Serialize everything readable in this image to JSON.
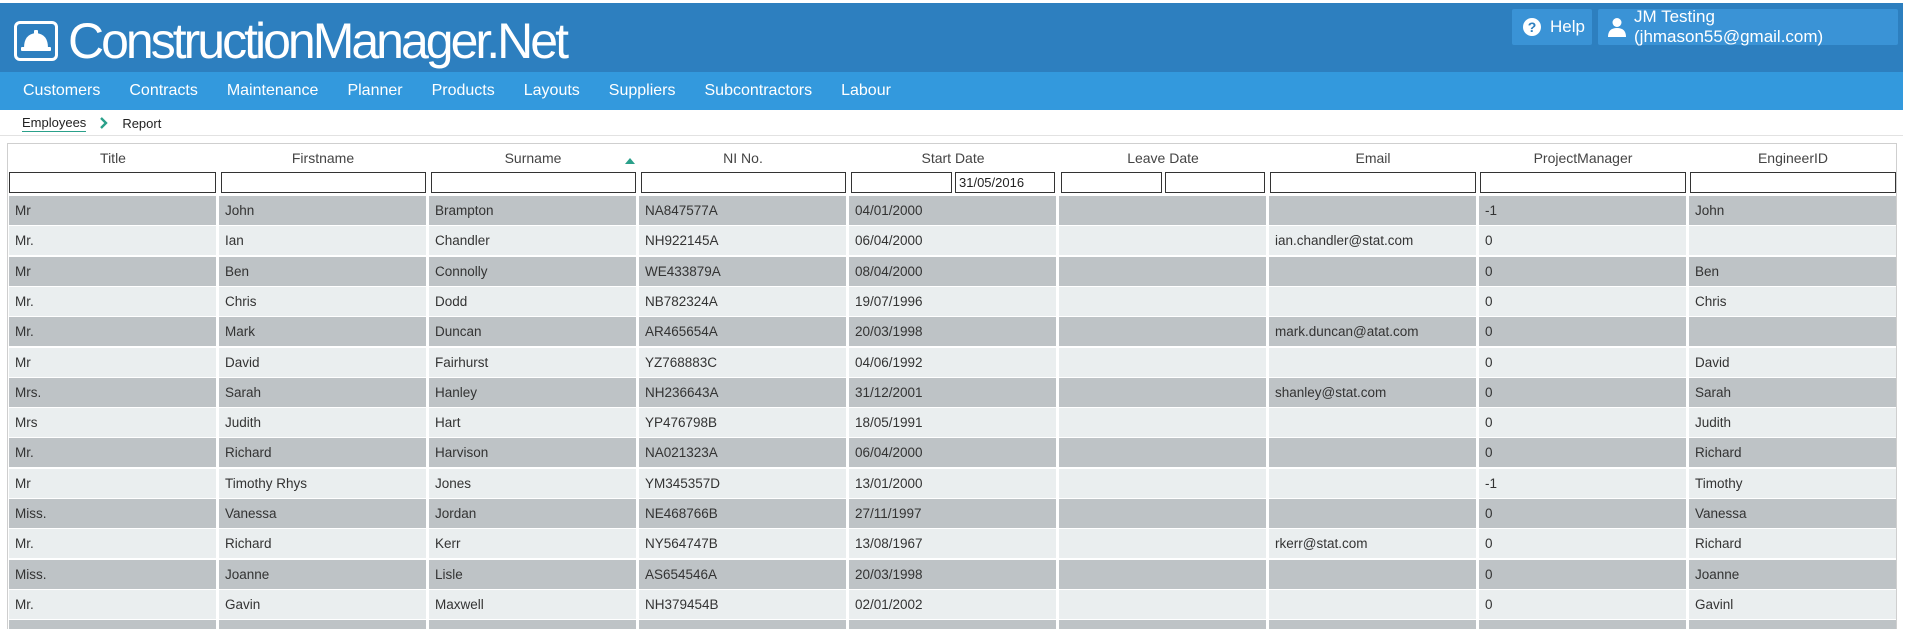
{
  "brand": {
    "name": "ConstructionManager.Net",
    "logo_icon": "hard-hat-icon"
  },
  "top_actions": {
    "help_label": "Help",
    "help_icon": "question-circle-icon",
    "user_label": "JM Testing (jhmason55@gmail.com)",
    "user_icon": "user-icon"
  },
  "nav": {
    "items": [
      "Customers",
      "Contracts",
      "Maintenance",
      "Planner",
      "Products",
      "Layouts",
      "Suppliers",
      "Subcontractors",
      "Labour"
    ]
  },
  "breadcrumb": {
    "items": [
      "Employees",
      "Report"
    ],
    "separator_icon": "chevron-right-icon"
  },
  "grid": {
    "columns": [
      "Title",
      "Firstname",
      "Surname",
      "NI No.",
      "Start Date",
      "Leave Date",
      "Email",
      "ProjectManager",
      "EngineerID"
    ],
    "sorted_column": "Surname",
    "sort_direction": "ascending",
    "filters": {
      "title": "",
      "firstname": "",
      "surname": "",
      "nino": "",
      "start_from": "",
      "start_to": "31/05/2016",
      "leave_from": "",
      "leave_to": "",
      "email": "",
      "project_manager": "",
      "engineer_id": ""
    },
    "rows": [
      [
        "Mr",
        "John",
        "Brampton",
        "NA847577A",
        "04/01/2000",
        "",
        "",
        "-1",
        "John"
      ],
      [
        "Mr.",
        "Ian",
        "Chandler",
        "NH922145A",
        "06/04/2000",
        "",
        "ian.chandler@stat.com",
        "0",
        ""
      ],
      [
        "Mr",
        "Ben",
        "Connolly",
        "WE433879A",
        "08/04/2000",
        "",
        "",
        "0",
        "Ben"
      ],
      [
        "Mr.",
        "Chris",
        "Dodd",
        "NB782324A",
        "19/07/1996",
        "",
        "",
        "0",
        "Chris"
      ],
      [
        "Mr.",
        "Mark",
        "Duncan",
        "AR465654A",
        "20/03/1998",
        "",
        "mark.duncan@atat.com",
        "0",
        ""
      ],
      [
        "Mr",
        "David",
        "Fairhurst",
        "YZ768883C",
        "04/06/1992",
        "",
        "",
        "0",
        "David"
      ],
      [
        "Mrs.",
        "Sarah",
        "Hanley",
        "NH236643A",
        "31/12/2001",
        "",
        "shanley@stat.com",
        "0",
        "Sarah"
      ],
      [
        "Mrs",
        "Judith",
        "Hart",
        "YP476798B",
        "18/05/1991",
        "",
        "",
        "0",
        "Judith"
      ],
      [
        "Mr.",
        "Richard",
        "Harvison",
        "NA021323A",
        "06/04/2000",
        "",
        "",
        "0",
        "Richard"
      ],
      [
        "Mr",
        "Timothy Rhys",
        "Jones",
        "YM345357D",
        "13/01/2000",
        "",
        "",
        "-1",
        "Timothy"
      ],
      [
        "Miss.",
        "Vanessa",
        "Jordan",
        "NE468766B",
        "27/11/1997",
        "",
        "",
        "0",
        "Vanessa"
      ],
      [
        "Mr.",
        "Richard",
        "Kerr",
        "NY564747B",
        "13/08/1967",
        "",
        "rkerr@stat.com",
        "0",
        "Richard"
      ],
      [
        "Miss.",
        "Joanne",
        "Lisle",
        "AS654546A",
        "20/03/1998",
        "",
        "",
        "0",
        "Joanne"
      ],
      [
        "Mr.",
        "Gavin",
        "Maxwell",
        "NH379454B",
        "02/01/2002",
        "",
        "",
        "0",
        "Gavinl"
      ]
    ]
  },
  "colors": {
    "header_blue": "#2d7fbf",
    "nav_blue": "#3399dd",
    "accent_teal": "#2aa08a",
    "row_dark": "#bec3c6",
    "row_light": "#eaeeef"
  }
}
